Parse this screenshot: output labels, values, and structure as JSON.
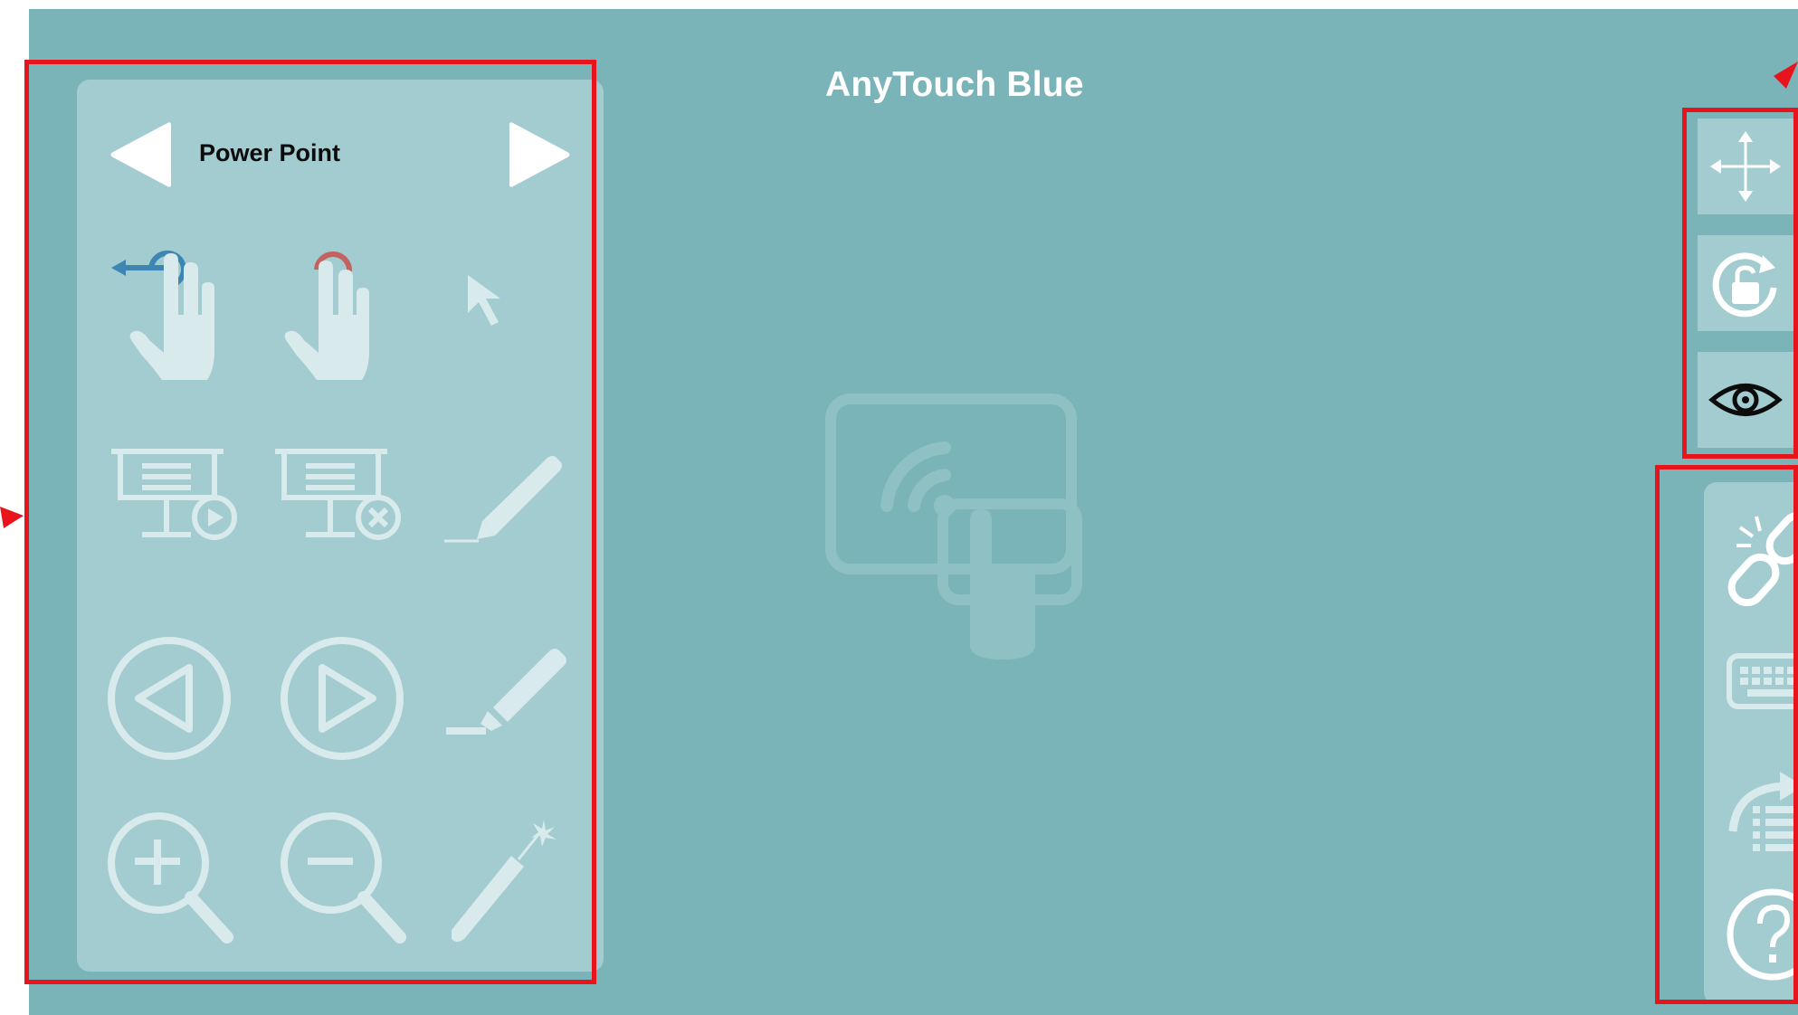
{
  "app": {
    "title": "AnyTouch Blue"
  },
  "mode_selector": {
    "label": "Power Point",
    "prev_icon": "triangle-left-icon",
    "next_icon": "triangle-right-icon"
  },
  "tools": [
    {
      "name": "swipe-left-gesture",
      "icon": "hand-swipe-left-icon"
    },
    {
      "name": "two-finger-tap-gesture",
      "icon": "hand-tap-icon"
    },
    {
      "name": "pointer-tool",
      "icon": "cursor-arrow-icon"
    },
    {
      "name": "start-slideshow",
      "icon": "presentation-play-icon"
    },
    {
      "name": "end-slideshow",
      "icon": "presentation-close-icon"
    },
    {
      "name": "pen-tool",
      "icon": "pencil-icon"
    },
    {
      "name": "previous-slide",
      "icon": "circle-triangle-left-icon"
    },
    {
      "name": "next-slide",
      "icon": "circle-triangle-right-icon"
    },
    {
      "name": "highlighter-tool",
      "icon": "highlighter-icon"
    },
    {
      "name": "zoom-in",
      "icon": "zoom-in-icon"
    },
    {
      "name": "zoom-out",
      "icon": "zoom-out-icon"
    },
    {
      "name": "laser-pointer",
      "icon": "laser-pointer-icon"
    }
  ],
  "side_controls": [
    {
      "name": "move-button",
      "icon": "move-arrows-icon"
    },
    {
      "name": "rotation-lock-button",
      "icon": "rotation-unlock-icon"
    },
    {
      "name": "visibility-button",
      "icon": "eye-icon"
    }
  ],
  "right_tools": [
    {
      "name": "disconnect-button",
      "icon": "broken-link-icon"
    },
    {
      "name": "keyboard-button",
      "icon": "keyboard-icon"
    },
    {
      "name": "share-list-button",
      "icon": "share-list-icon"
    },
    {
      "name": "help-button",
      "icon": "question-circle-icon"
    }
  ],
  "colors": {
    "background": "#7ab4b8",
    "panel": "#a3ccd0",
    "icon": "#d8eaec",
    "highlight_box": "#e8141b",
    "swipe_accent": "#3d86b4",
    "tap_accent": "#c4625f"
  }
}
